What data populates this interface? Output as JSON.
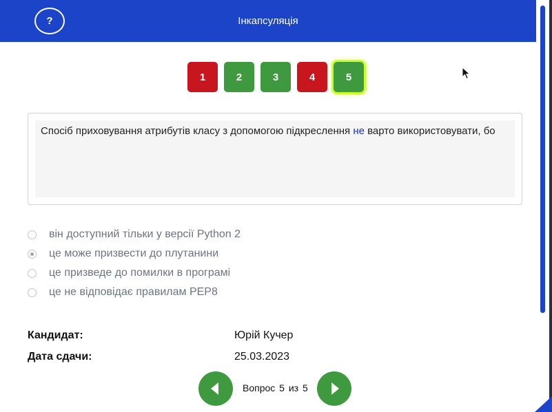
{
  "header": {
    "help_label": "?",
    "title": "Інкапсуляція"
  },
  "question_nav": [
    {
      "label": "1",
      "status": "wrong"
    },
    {
      "label": "2",
      "status": "correct"
    },
    {
      "label": "3",
      "status": "correct"
    },
    {
      "label": "4",
      "status": "wrong"
    },
    {
      "label": "5",
      "status": "correct",
      "current": true
    }
  ],
  "question": {
    "text_before": "Спосіб приховування атрибутів класу з допомогою підкреслення ",
    "keyword": "не",
    "text_after": " варто використовувати, бо"
  },
  "options": [
    {
      "label": "він доступний тільки у версії Python 2",
      "selected": false
    },
    {
      "label": "це може призвести до плутанини",
      "selected": true
    },
    {
      "label": "це призведе до помилки в програмі",
      "selected": false
    },
    {
      "label": "це не відповідає правилам PEP8",
      "selected": false
    }
  ],
  "info": {
    "candidate_label": "Кандидат:",
    "candidate_value": "Юрій Кучер",
    "date_label": "Дата сдачи:",
    "date_value": "25.03.2023"
  },
  "pager": {
    "text": "Вопрос 5 из 5"
  },
  "colors": {
    "header": "#1b44c8",
    "correct": "#3f9a3f",
    "wrong": "#c7161d",
    "current_highlight": "#c8ff2a"
  }
}
